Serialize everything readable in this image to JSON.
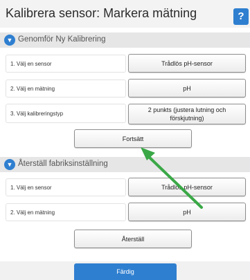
{
  "header": {
    "title": "Kalibrera sensor: Markera mätning",
    "help_label": "?"
  },
  "section1": {
    "title": "Genomför Ny Kalibrering",
    "rows": [
      {
        "label": "1. Välj en sensor",
        "value": "Trådlös pH-sensor"
      },
      {
        "label": "2. Välj en mätning",
        "value": "pH"
      },
      {
        "label": "3. Välj kalibreringstyp",
        "value": "2 punkts (justera lutning och förskjutning)"
      }
    ],
    "continue_label": "Fortsätt"
  },
  "section2": {
    "title": "Återställ fabriksinställning",
    "rows": [
      {
        "label": "1. Välj en sensor",
        "value": "Trådlös pH-sensor"
      },
      {
        "label": "2. Välj en mätning",
        "value": "pH"
      }
    ],
    "reset_label": "Återställ"
  },
  "footer": {
    "done_label": "Färdig"
  },
  "colors": {
    "accent": "#2f7fd0",
    "arrow": "#3aa846"
  }
}
